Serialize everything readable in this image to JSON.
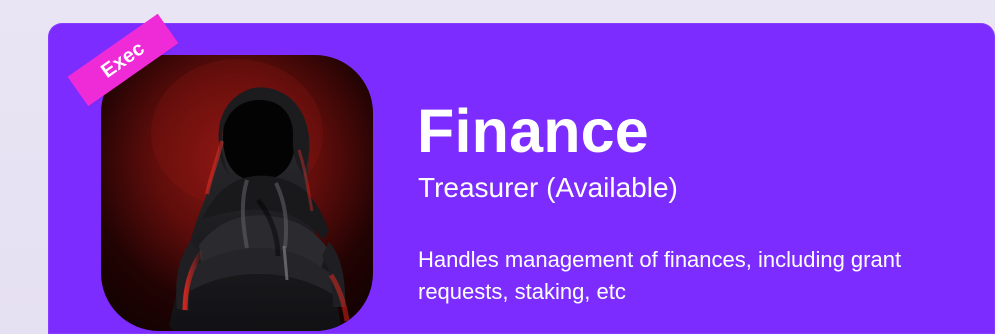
{
  "card": {
    "badge_label": "Exec",
    "title": "Finance",
    "role": "Treasurer (Available)",
    "description": "Handles management of finances, including grant requests, staking, etc",
    "colors": {
      "page_background": "#e7e2f3",
      "card_background": "#7d2cff",
      "badge_background": "#ef2bd8",
      "text": "#ffffff",
      "avatar_red": "#8d1713",
      "avatar_dark": "#0d0101"
    },
    "avatar": {
      "icon": "hooded-person-icon"
    }
  }
}
